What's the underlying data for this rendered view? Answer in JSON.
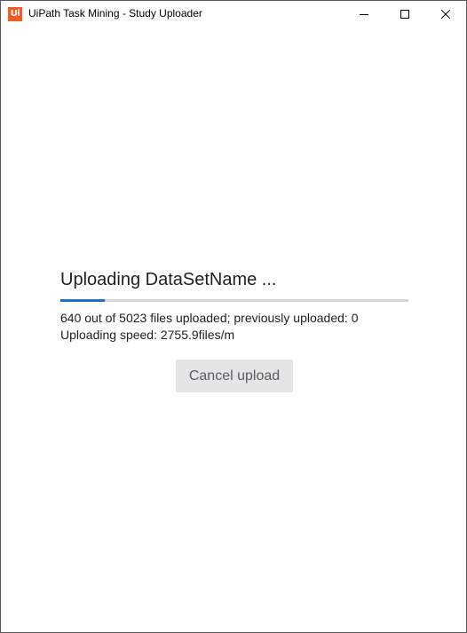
{
  "window": {
    "title": "UiPath Task Mining - Study Uploader",
    "logo_text": "Ui",
    "logo_color": "#f15a24",
    "controls": {
      "minimize_icon": "minimize-icon",
      "maximize_icon": "maximize-icon",
      "close_icon": "close-icon"
    }
  },
  "upload": {
    "heading": "Uploading DataSetName ...",
    "progress": {
      "uploaded": 640,
      "total": 5023,
      "fraction": 0.1274,
      "color": "#1e6fd0"
    },
    "status_text": "640 out of 5023 files uploaded; previously uploaded: 0",
    "speed_text": "Uploading speed: 2755.9files/m",
    "cancel_label": "Cancel upload"
  }
}
